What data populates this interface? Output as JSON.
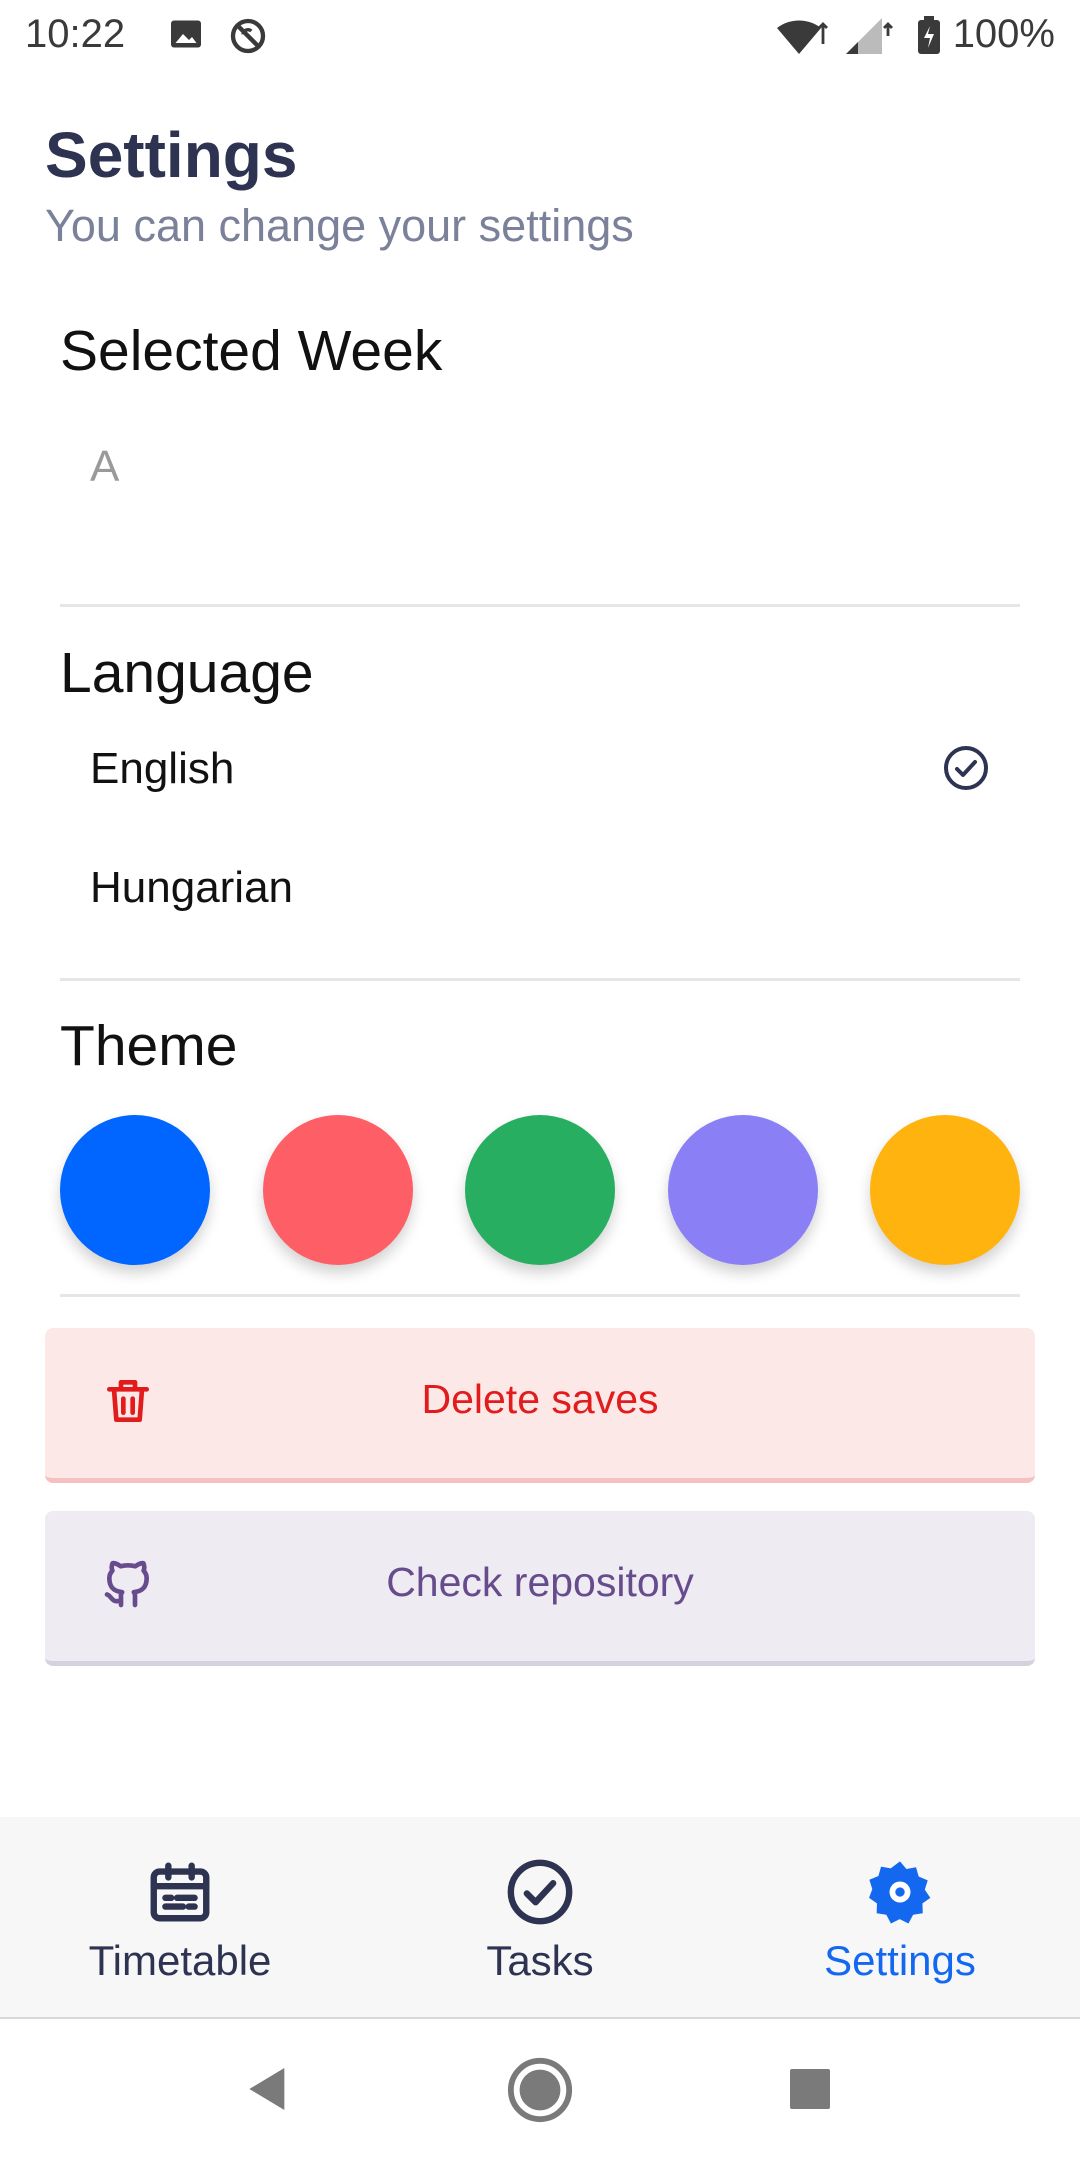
{
  "status_bar": {
    "time": "10:22",
    "battery": "100%",
    "icons": [
      "image-icon",
      "sync-off-icon",
      "wifi-icon",
      "signal-icon",
      "battery-charging-icon"
    ]
  },
  "header": {
    "title": "Settings",
    "subtitle": "You can change your settings"
  },
  "week": {
    "title": "Selected Week",
    "value": "A"
  },
  "language": {
    "title": "Language",
    "options": [
      {
        "label": "English",
        "selected": true
      },
      {
        "label": "Hungarian",
        "selected": false
      }
    ]
  },
  "theme": {
    "title": "Theme",
    "colors": [
      "#0066ff",
      "#fe5e65",
      "#27ae60",
      "#8a7ff5",
      "#ffb30f"
    ]
  },
  "actions": {
    "delete_label": "Delete saves",
    "repo_label": "Check repository"
  },
  "bottom_nav": {
    "items": [
      {
        "label": "Timetable",
        "icon": "calendar-icon",
        "active": false
      },
      {
        "label": "Tasks",
        "icon": "check-circle-icon",
        "active": false
      },
      {
        "label": "Settings",
        "icon": "gear-icon",
        "active": true
      }
    ]
  },
  "colors": {
    "accent": "#1468f0",
    "title": "#2d3350",
    "danger": "#e21b1b",
    "repo": "#674c8d"
  }
}
